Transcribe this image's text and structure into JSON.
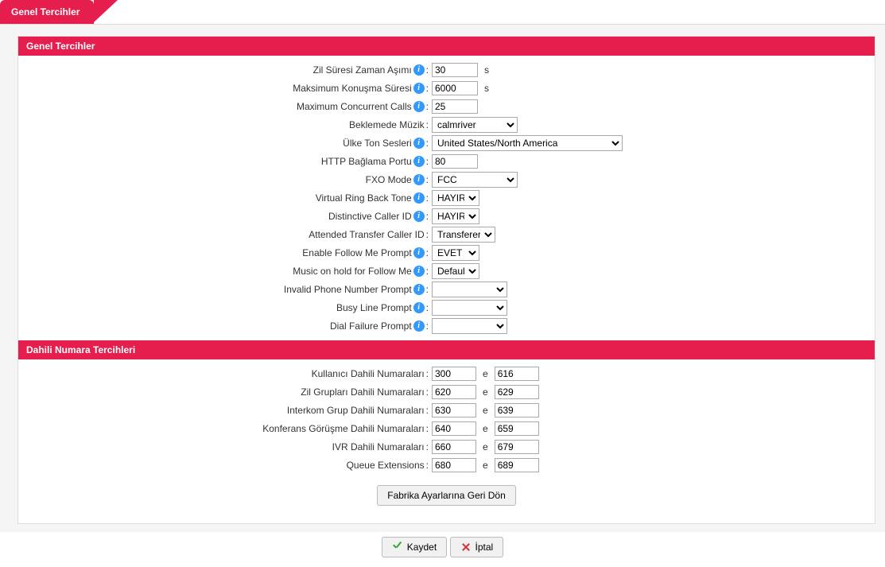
{
  "page": {
    "tab_title": "Genel Tercihler"
  },
  "sections": {
    "general": {
      "title": "Genel Tercihler"
    },
    "extensions": {
      "title": "Dahili Numara Tercihleri"
    }
  },
  "general": {
    "ring_timeout": {
      "label": "Zil Süresi Zaman Aşımı",
      "value": "30",
      "unit": "s"
    },
    "max_call_duration": {
      "label": "Maksimum Konuşma Süresi",
      "value": "6000",
      "unit": "s"
    },
    "max_concurrent_calls": {
      "label": "Maximum Concurrent Calls",
      "value": "25"
    },
    "music_on_hold": {
      "label": "Beklemede Müzik",
      "value": "calmriver"
    },
    "country_tones": {
      "label": "Ülke Ton Sesleri",
      "value": "United States/North America"
    },
    "http_port": {
      "label": "HTTP Bağlama Portu",
      "value": "80"
    },
    "fxo_mode": {
      "label": "FXO Mode",
      "value": "FCC"
    },
    "virtual_ringback": {
      "label": "Virtual Ring Back Tone",
      "value": "HAYIR"
    },
    "distinctive_cid": {
      "label": "Distinctive Caller ID",
      "value": "HAYIR"
    },
    "attended_transfer_cid": {
      "label": "Attended Transfer Caller ID",
      "value": "Transferer"
    },
    "follow_me_prompt": {
      "label": "Enable Follow Me Prompt",
      "value": "EVET"
    },
    "follow_me_moh": {
      "label": "Music on hold for Follow Me",
      "value": "Default"
    },
    "invalid_number_prompt": {
      "label": "Invalid Phone Number Prompt",
      "value": ""
    },
    "busy_line_prompt": {
      "label": "Busy Line Prompt",
      "value": ""
    },
    "dial_failure_prompt": {
      "label": "Dial Failure Prompt",
      "value": ""
    }
  },
  "extensions": {
    "separator": "e",
    "user": {
      "label": "Kullanıcı Dahili Numaraları",
      "from": "300",
      "to": "616"
    },
    "ring_groups": {
      "label": "Zil Grupları Dahili Numaraları",
      "from": "620",
      "to": "629"
    },
    "intercom_groups": {
      "label": "Interkom Grup Dahili Numaraları",
      "from": "630",
      "to": "639"
    },
    "conference": {
      "label": "Konferans Görüşme Dahili Numaraları",
      "from": "640",
      "to": "659"
    },
    "ivr": {
      "label": "IVR Dahili Numaraları",
      "from": "660",
      "to": "679"
    },
    "queue": {
      "label": "Queue Extensions",
      "from": "680",
      "to": "689"
    }
  },
  "buttons": {
    "factory_defaults": "Fabrika Ayarlarına Geri Dön",
    "save": "Kaydet",
    "cancel": "İptal"
  }
}
